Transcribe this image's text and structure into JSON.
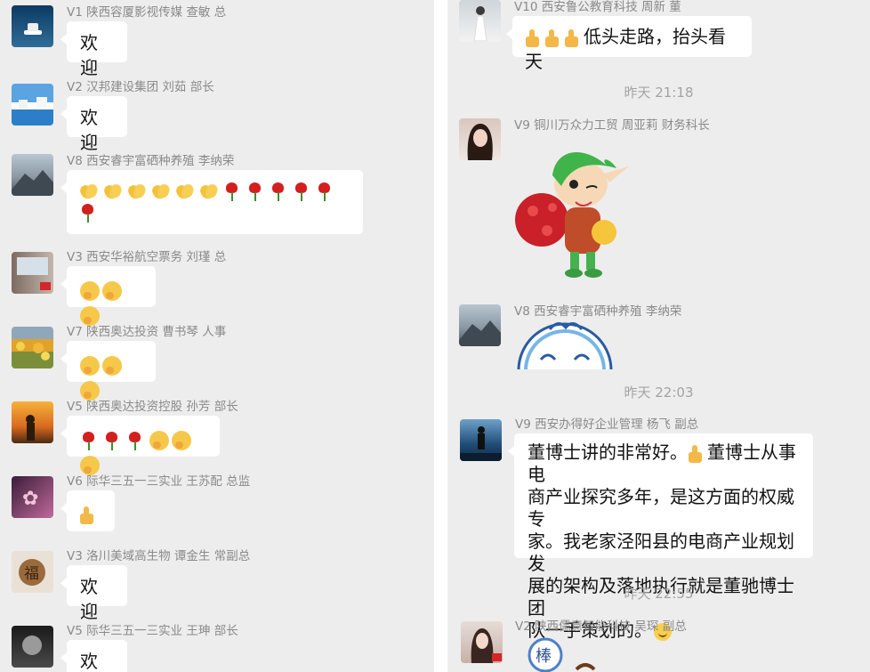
{
  "left_messages": [
    {
      "sender": "V1 陕西容厦影视传媒 查敏 总",
      "text": "欢迎"
    },
    {
      "sender": "V2 汉邦建设集团 刘茹 部长",
      "text": "欢迎"
    },
    {
      "sender": "V8 西安睿宇富硒种养殖 李纳荣",
      "emoji": "6 clapping hands, 6 red roses"
    },
    {
      "sender": "V3 西安华裕航空票务 刘瑾 总",
      "emoji": "3 hug emoji"
    },
    {
      "sender": "V7 陕西奥达投资 曹书琴 人事",
      "emoji": "3 hug emoji"
    },
    {
      "sender": "V5 陕西奥达投资控股 孙芳 部长",
      "emoji": "3 roses, 3 hug emoji"
    },
    {
      "sender": "V6 际华三五一三实业 王苏配 总监",
      "emoji": "thumbs up"
    },
    {
      "sender": "V3 洛川美域高生物 谭金生 常副总",
      "text": "欢迎"
    },
    {
      "sender": "V5 际华三五一三实业 王珅 部长",
      "text": "欢迎"
    }
  ],
  "right_messages": {
    "m1": {
      "sender": "V10 西安鲁公教育科技 周新 董",
      "text": "低头走路，抬头看天"
    },
    "t1": "昨天 21:18",
    "m2": {
      "sender": "V9 铜川万众力工贸 周亚莉 财务科长"
    },
    "m3": {
      "sender": "V8 西安睿宇富硒种养殖 李纳荣"
    },
    "t2": "昨天 22:03",
    "m4": {
      "sender": "V9 西安办得好企业管理 杨飞 副总",
      "line1a": "董博士讲的非常好。",
      "line1b": "董博士从事电",
      "line2": "商产业探究多年，是这方面的权威专",
      "line3": "家。我老家泾阳县的电商产业规划发",
      "line4": "展的架构及落地执行就是董驰博士团",
      "line5": "队一手策划的。"
    },
    "t3": "昨天 22:55",
    "m5": {
      "sender": "V2 陕西儒意智能科技 吴琛 副总",
      "sticker_text": "棒"
    }
  },
  "colors": {
    "panel_bg": "#ededed",
    "bubble_bg": "#ffffff",
    "meta_text": "#8a8a8a",
    "time_text": "#a3a3a3"
  }
}
